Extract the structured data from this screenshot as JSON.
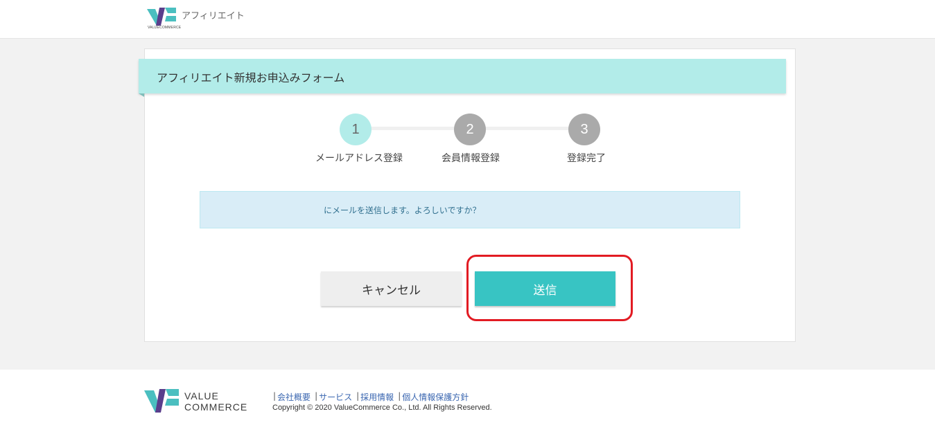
{
  "header": {
    "brand_sub": "VALUECOMMERCE",
    "title": "アフィリエイト"
  },
  "form": {
    "title": "アフィリエイト新規お申込みフォーム",
    "steps": [
      {
        "number": "1",
        "label": "メールアドレス登録",
        "state": "active"
      },
      {
        "number": "2",
        "label": "会員情報登録",
        "state": "inactive"
      },
      {
        "number": "3",
        "label": "登録完了",
        "state": "inactive"
      }
    ],
    "message": "にメールを送信します。よろしいですか？",
    "cancel_label": "キャンセル",
    "send_label": "送信"
  },
  "footer": {
    "brand_line1": "VALUE",
    "brand_line2": "COMMERCE",
    "links": [
      {
        "label": "会社概要"
      },
      {
        "label": "サービス"
      },
      {
        "label": "採用情報"
      },
      {
        "label": "個人情報保護方針"
      }
    ],
    "separator": "|",
    "copyright": "Copyright © 2020 ValueCommerce Co., Ltd. All Rights Reserved."
  },
  "colors": {
    "accent": "#38c4c3",
    "title_bar": "#b2ece9",
    "step_active": "#b2ece9",
    "step_inactive": "#aaaaaa",
    "alert_bg": "#d9edf7",
    "highlight": "#e21b23",
    "logo_teal": "#4bbfc0",
    "logo_purple": "#5a3e8c"
  }
}
